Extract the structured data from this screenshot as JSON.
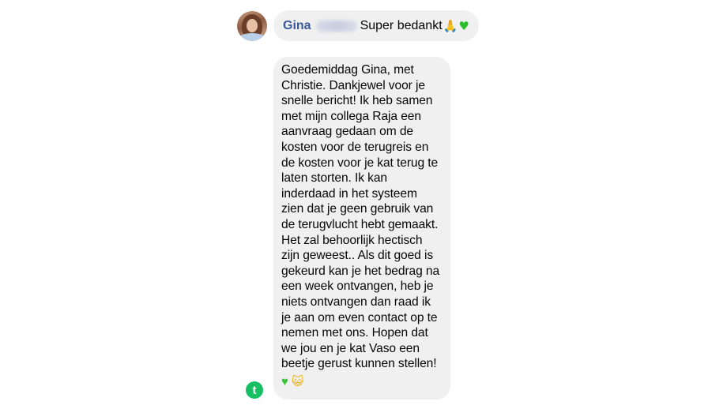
{
  "incoming": {
    "sender_name": "Gina",
    "text": "Super bedankt",
    "emoji_1": "🙏",
    "emoji_2": "♥"
  },
  "outgoing": {
    "lines": [
      "Goedemiddag Gina, met",
      "Christie. Dankjewel voor je",
      "snelle bericht! Ik heb samen",
      "met mijn collega Raja een",
      "aanvraag gedaan om de",
      "kosten voor de terugreis en",
      "de kosten voor je kat terug te",
      "laten storten. Ik kan",
      "inderdaad in het systeem",
      "zien dat je geen gebruik van",
      "de terugvlucht hebt gemaakt.",
      "Het zal behoorlijk hectisch",
      "zijn geweest.. Als dit goed is",
      "gekeurd kan je het bedrag na",
      "een week ontvangen, heb je",
      "niets ontvangen dan raad ik",
      "je aan om even contact op te",
      "nemen met ons. Hopen dat",
      "we jou en je kat Vaso een",
      "beetje gerust kunnen stellen!"
    ],
    "emoji_1": "♥",
    "emoji_2": "😺",
    "badge_letter": "t"
  },
  "icons": {
    "avatar": "avatar-image",
    "badge": "brand-badge-icon"
  },
  "colors": {
    "bubble": "#f0f0f0",
    "sender_name": "#385898",
    "badge": "#17bf63"
  }
}
